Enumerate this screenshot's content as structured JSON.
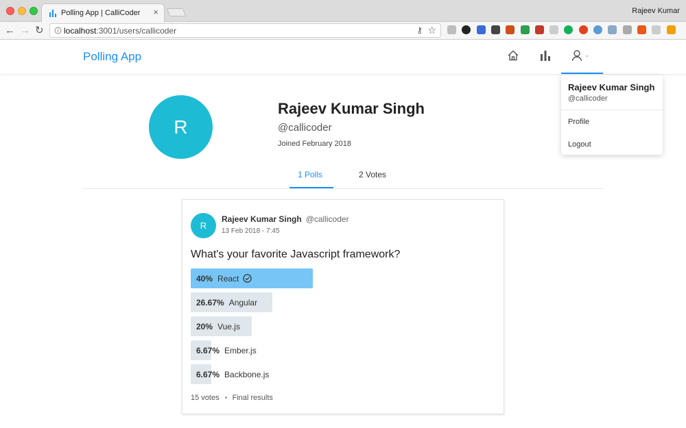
{
  "browser": {
    "tab_title": "Polling App | CalliCoder",
    "tab_close": "×",
    "profile_name": "Rajeev Kumar",
    "url_host": "localhost",
    "url_path": ":3001/users/callicoder",
    "extension_colors": [
      "#bdbdbd",
      "#222222",
      "#3b6bd6",
      "#444444",
      "#d04f18",
      "#2e9e4f",
      "#c0392b",
      "#cccccc",
      "#15b15b",
      "#e0441f",
      "#5b9bd5",
      "#8aa8c8",
      "#aaaaaa",
      "#e8591a",
      "#cccccc",
      "#f0a000"
    ]
  },
  "app": {
    "brand": "Polling App",
    "accent_color": "#1890ff",
    "nav": [
      "home-icon",
      "bar-chart-icon",
      "user-icon"
    ],
    "caret": "⌄"
  },
  "dropdown": {
    "name": "Rajeev Kumar Singh",
    "handle": "@callicoder",
    "items": [
      "Profile",
      "Logout"
    ]
  },
  "profile": {
    "avatar_letter": "R",
    "name": "Rajeev Kumar Singh",
    "handle": "@callicoder",
    "joined": "Joined February 2018",
    "tabs": [
      "1 Polls",
      "2 Votes"
    ],
    "active_tab": "1 Polls"
  },
  "poll": {
    "avatar_letter": "R",
    "creator_name": "Rajeev Kumar Singh",
    "creator_handle": "@callicoder",
    "created": "13 Feb 2018 - 7:45",
    "question": "What's your favorite Javascript framework?",
    "choices": [
      {
        "percent": "40%",
        "label": "React",
        "share": 0.4,
        "selected": true
      },
      {
        "percent": "26.67%",
        "label": "Angular",
        "share": 0.2667,
        "selected": false
      },
      {
        "percent": "20%",
        "label": "Vue.js",
        "share": 0.2,
        "selected": false
      },
      {
        "percent": "6.67%",
        "label": "Ember.js",
        "share": 0.0667,
        "selected": false
      },
      {
        "percent": "6.67%",
        "label": "Backbone.js",
        "share": 0.0667,
        "selected": false
      }
    ],
    "total_votes": "15 votes",
    "status": "Final results"
  }
}
